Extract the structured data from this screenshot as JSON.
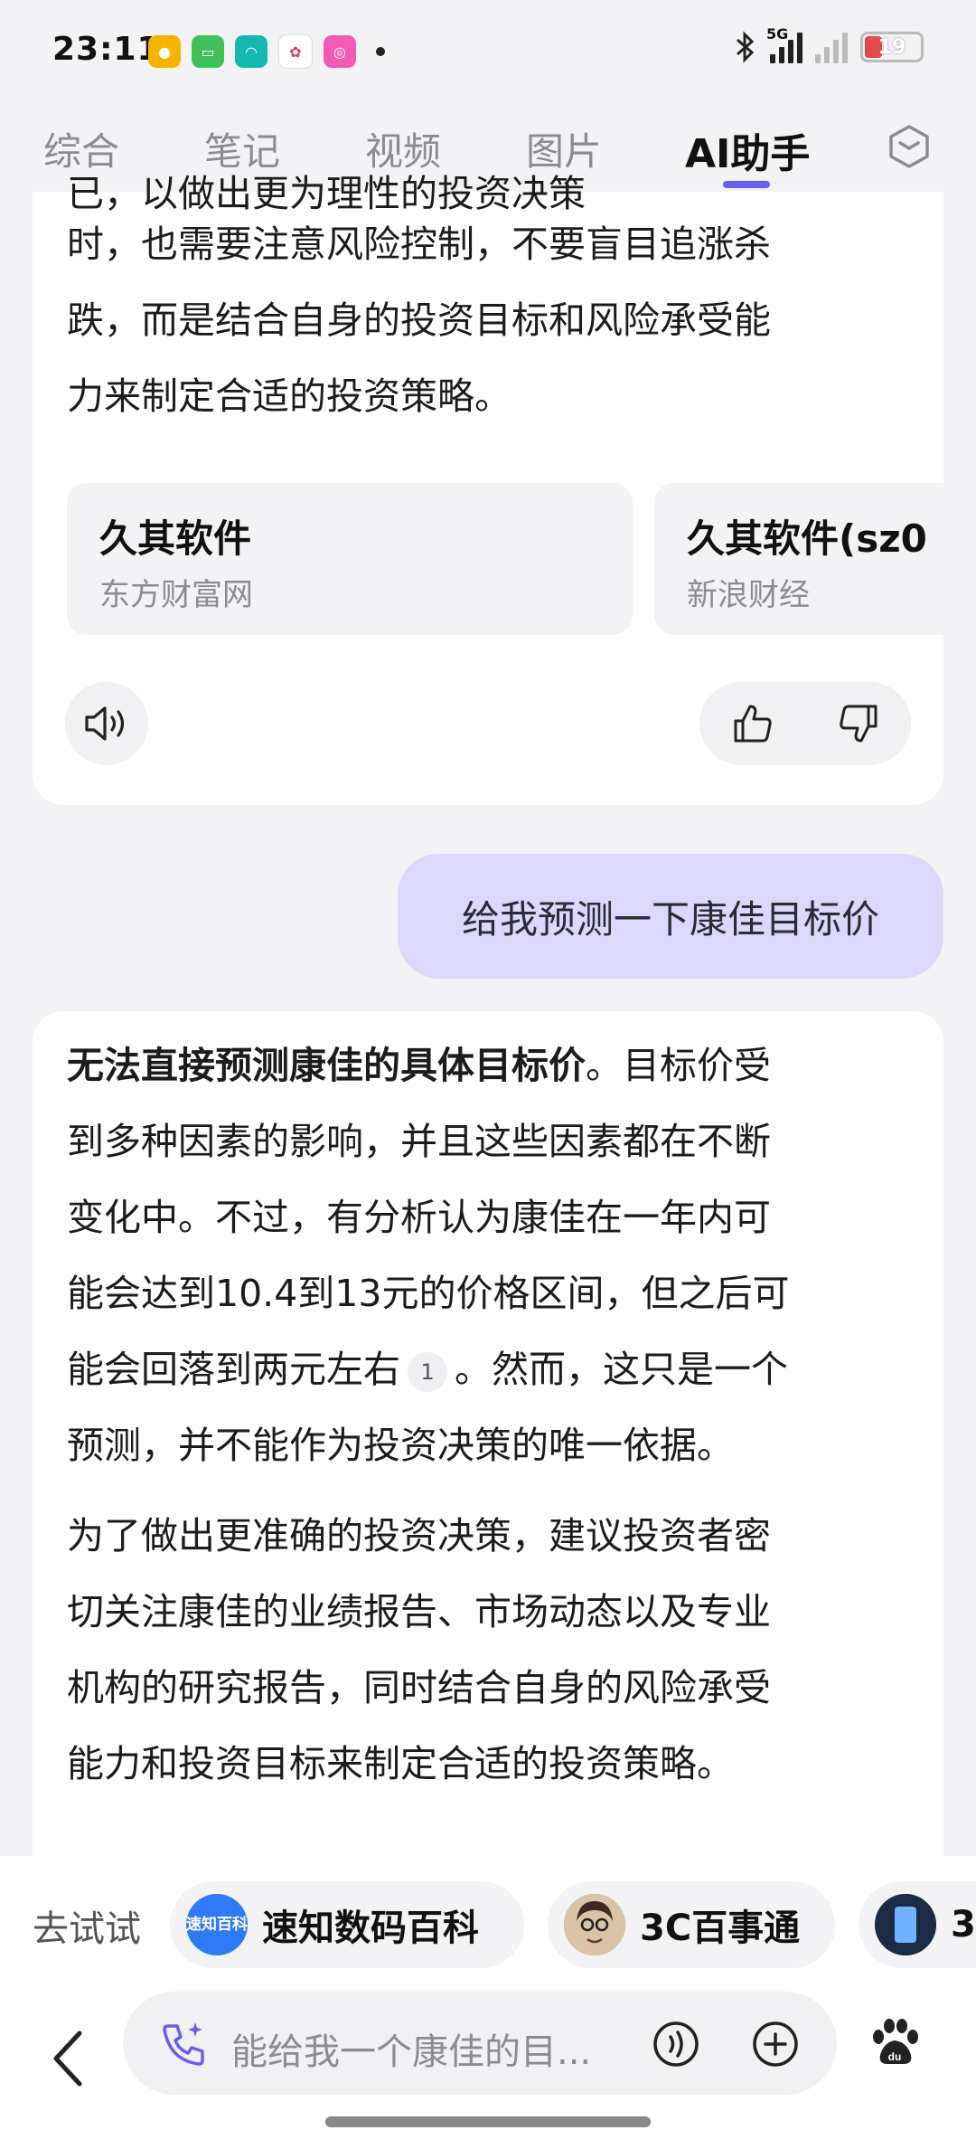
{
  "status_bar": {
    "time": "23:11",
    "network": "5G",
    "battery": "19",
    "icons": [
      "bluetooth-icon",
      "signal-icon",
      "battery-icon"
    ]
  },
  "tabs": [
    {
      "label": "综合"
    },
    {
      "label": "笔记"
    },
    {
      "label": "视频"
    },
    {
      "label": "图片"
    },
    {
      "label": "AI助手",
      "active": true
    }
  ],
  "answer1": {
    "partial_line": "已，以做出更为理性的投资决策",
    "lines": [
      "时，也需要注意风险控制，不要盲目追涨杀",
      "跌，而是结合自身的投资目标和风险承受能",
      "力来制定合适的投资策略。"
    ],
    "sources": [
      {
        "title": "久其软件",
        "site": "东方财富网"
      },
      {
        "title": "久其软件(sz0",
        "site": "新浪财经"
      }
    ]
  },
  "user_message": "给我预测一下康佳目标价",
  "answer2": {
    "bold_lead": "无法直接预测康佳的具体目标价",
    "p1_after_bold": "。目标价受",
    "p1_lines": [
      "到多种因素的影响，并且这些因素都在不断",
      "变化中。不过，有分析认为康佳在一年内可",
      "能会达到10.4到13元的价格区间，但之后可"
    ],
    "p1_cite_before": "能会回落到两元左右",
    "cite": "1",
    "p1_cite_after": "。然而，这只是一个",
    "p1_last": "预测，并不能作为投资决策的唯一依据。",
    "p2_lines": [
      "为了做出更准确的投资决策，建议投资者密",
      "切关注康佳的业绩报告、市场动态以及专业",
      "机构的研究报告，同时结合自身的风险承受",
      "能力和投资目标来制定合适的投资策略。"
    ]
  },
  "try_bar": {
    "label": "去试试",
    "chips": [
      {
        "name": "速知数码百科",
        "avatar_text": "速知百科"
      },
      {
        "name": "3C百事通"
      },
      {
        "name": "3"
      }
    ]
  },
  "input": {
    "placeholder": "能给我一个康佳的目..."
  },
  "colors": {
    "accent": "#6b5cf0",
    "user_bubble": "#dcd8fb",
    "battery_low": "#e14b4b"
  }
}
